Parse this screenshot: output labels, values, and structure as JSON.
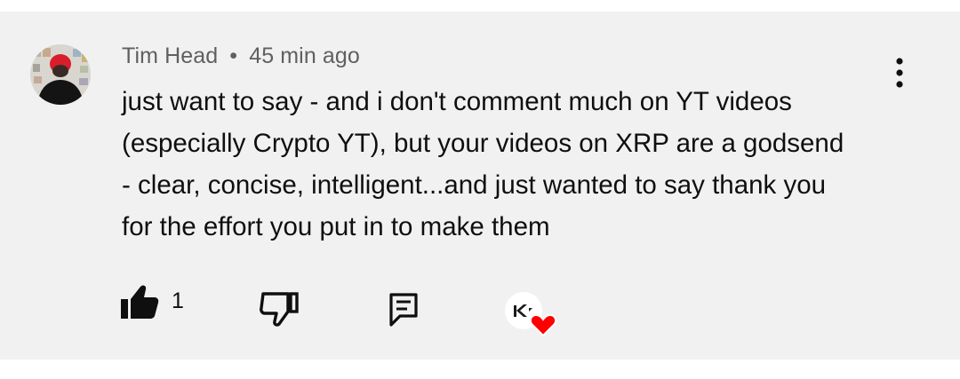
{
  "comment": {
    "author": "Tim Head",
    "separator": "•",
    "timestamp": "45 min ago",
    "text": "just want to say - and i don't comment much on YT videos\n(especially Crypto YT), but your videos on XRP are a godsend\n- clear, concise, intelligent...and just wanted to say thank you\nfor the effort you put in to make them",
    "like_count": "1"
  },
  "icons": {
    "menu": "more-vert-icon",
    "like": "thumb-up-filled-icon",
    "dislike": "thumb-down-outline-icon",
    "reply": "reply-comment-icon",
    "creator_heart": "creator-heart-icon"
  },
  "colors": {
    "card_background": "#f1f1f1",
    "text_primary": "#0f0f0f",
    "text_secondary": "#606060",
    "heart": "#ff0000"
  }
}
